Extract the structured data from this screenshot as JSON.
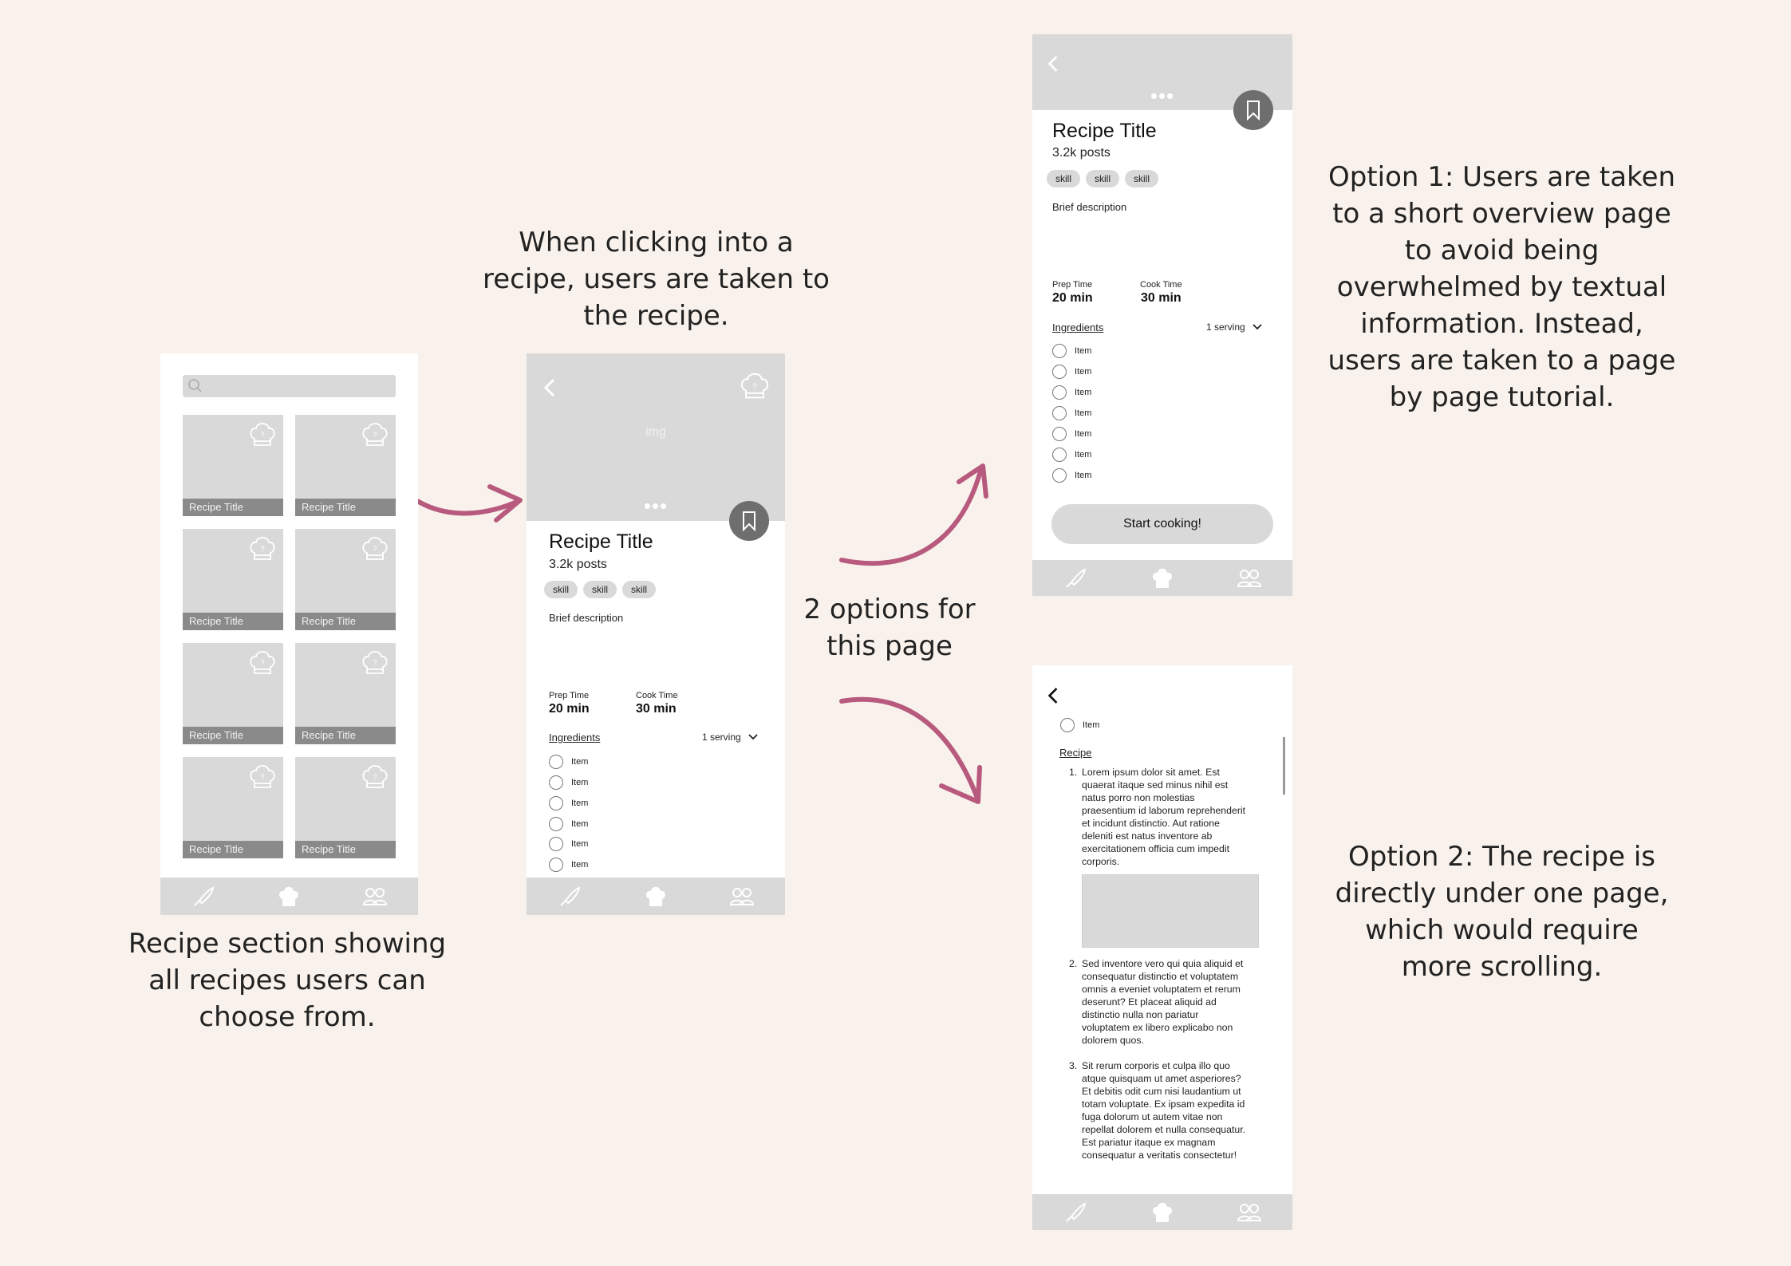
{
  "colors": {
    "background": "#f9f2ec",
    "arrow": "#b85a7d",
    "placeholder": "#d9d9d9",
    "label_bar": "#8a8a8a"
  },
  "captions": {
    "grid": [
      "Recipe section showing",
      "all recipes users can",
      "choose from."
    ],
    "detail": [
      "When clicking into a",
      "recipe, users are taken to",
      "the recipe."
    ],
    "options": [
      "2 options for",
      "this page"
    ],
    "option1": [
      "Option 1: Users are taken",
      "to a short overview page",
      "to avoid being",
      "overwhelmed by textual",
      "information. Instead,",
      "users are taken to a page",
      "by page tutorial."
    ],
    "option2": [
      "Option 2: The recipe is",
      "directly under one page,",
      "which would require",
      "more scrolling."
    ]
  },
  "grid_screen": {
    "cards": [
      {
        "label": "Recipe Title"
      },
      {
        "label": "Recipe Title"
      },
      {
        "label": "Recipe Title"
      },
      {
        "label": "Recipe Title"
      },
      {
        "label": "Recipe Title"
      },
      {
        "label": "Recipe Title"
      },
      {
        "label": "Recipe Title"
      },
      {
        "label": "Recipe Title"
      }
    ],
    "nav_icons": [
      "knife-icon",
      "chef-hat-icon",
      "users-icon"
    ]
  },
  "recipe": {
    "img_placeholder": "img",
    "title": "Recipe Title",
    "posts": "3.2k posts",
    "skills": [
      "skill",
      "skill",
      "skill"
    ],
    "brief": "Brief description",
    "prep_label": "Prep Time",
    "prep_value": "20 min",
    "cook_label": "Cook Time",
    "cook_value": "30 min",
    "ingredients_label": "Ingredients",
    "serving": "1 serving",
    "item_label": "Item",
    "start_button": "Start cooking!"
  },
  "steps_screen": {
    "item": "Item",
    "recipe_label": "Recipe",
    "steps": [
      {
        "num": "1.",
        "lines": [
          "Lorem ipsum dolor sit amet. Est",
          "quaerat itaque sed minus nihil est",
          "natus porro non molestias",
          "praesentium id laborum reprehenderit",
          "et incidunt distinctio. Aut ratione",
          "deleniti est natus inventore ab",
          "exercitationem officia cum impedit",
          "corporis."
        ]
      },
      {
        "num": "2.",
        "lines": [
          "Sed inventore vero qui quia aliquid et",
          "consequatur distinctio et voluptatem",
          "omnis a eveniet voluptatem et rerum",
          "deserunt? Et placeat aliquid ad",
          "distinctio nulla non pariatur",
          "voluptatem ex libero explicabo non",
          "dolorem quos."
        ]
      },
      {
        "num": "3.",
        "lines": [
          "Sit rerum corporis et culpa illo quo",
          "atque quisquam ut amet asperiores?",
          "Et debitis odit cum nisi laudantium ut",
          "totam voluptate. Ex ipsam expedita id",
          "fuga dolorum ut autem vitae non",
          "repellat dolorem et nulla consequatur.",
          "Est pariatur itaque ex magnam",
          "consequatur a veritatis consectetur!"
        ]
      }
    ]
  }
}
